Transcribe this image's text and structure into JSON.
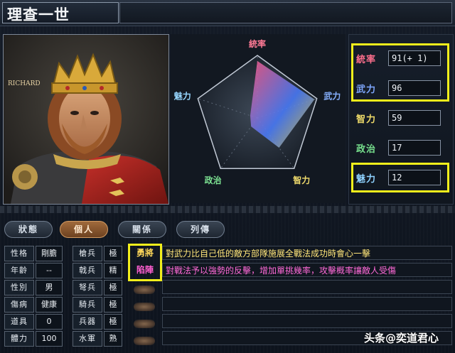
{
  "title": "理查一世",
  "portrait": {
    "caption": "RICHARD"
  },
  "radar": {
    "labels": {
      "top": "統率",
      "right": "武力",
      "bottom_right": "智力",
      "bottom_left": "政治",
      "left": "魅力"
    },
    "values": {
      "統率": 91,
      "武力": 96,
      "智力": 59,
      "政治": 17,
      "魅力": 12
    },
    "max": 100,
    "colors": {
      "統率": "#ff5b8a",
      "武力": "#4a7dff",
      "智力": "#e8d24a",
      "政治": "#53d16d",
      "魅力": "#9bd7ff"
    }
  },
  "stats": [
    {
      "label": "統率",
      "value": "91(+ 1)",
      "color": "#ff6f8d",
      "highlighted": true
    },
    {
      "label": "武力",
      "value": "96",
      "color": "#7fa8ff",
      "highlighted": true
    },
    {
      "label": "智力",
      "value": "59",
      "color": "#f1dd6a",
      "highlighted": false
    },
    {
      "label": "政治",
      "value": "17",
      "color": "#77e08d",
      "highlighted": false
    },
    {
      "label": "魅力",
      "value": "12",
      "color": "#8fd2ff",
      "highlighted": true
    }
  ],
  "tabs": [
    {
      "label": "狀態",
      "active": false
    },
    {
      "label": "個人",
      "active": true
    },
    {
      "label": "關係",
      "active": false
    },
    {
      "label": "列傳",
      "active": false
    }
  ],
  "personal": [
    {
      "label": "性格",
      "value": "剛膽"
    },
    {
      "label": "年齡",
      "value": "--"
    },
    {
      "label": "性別",
      "value": "男"
    },
    {
      "label": "傷病",
      "value": "健康"
    },
    {
      "label": "道具",
      "value": "0"
    },
    {
      "label": "體力",
      "value": "100"
    }
  ],
  "troops": [
    {
      "label": "槍兵",
      "value": "極"
    },
    {
      "label": "戟兵",
      "value": "精"
    },
    {
      "label": "弩兵",
      "value": "極"
    },
    {
      "label": "騎兵",
      "value": "極"
    },
    {
      "label": "兵器",
      "value": "極"
    },
    {
      "label": "水軍",
      "value": "熟"
    }
  ],
  "skills": [
    {
      "name": "勇將",
      "name_color": "#ffd85a",
      "desc": "對武力比自己低的敵方部隊施展全戰法成功時會心一擊",
      "desc_color": "#ffe67a"
    },
    {
      "name": "陷陣",
      "name_color": "#ff5fd0",
      "desc": "對戰法予以強勢的反擊，增加單挑幾率，攻擊概率讓敵人受傷",
      "desc_color": "#ff6ad8"
    }
  ],
  "watermark": "头条@奕道君心",
  "highlight_color": "#f2ef1b"
}
